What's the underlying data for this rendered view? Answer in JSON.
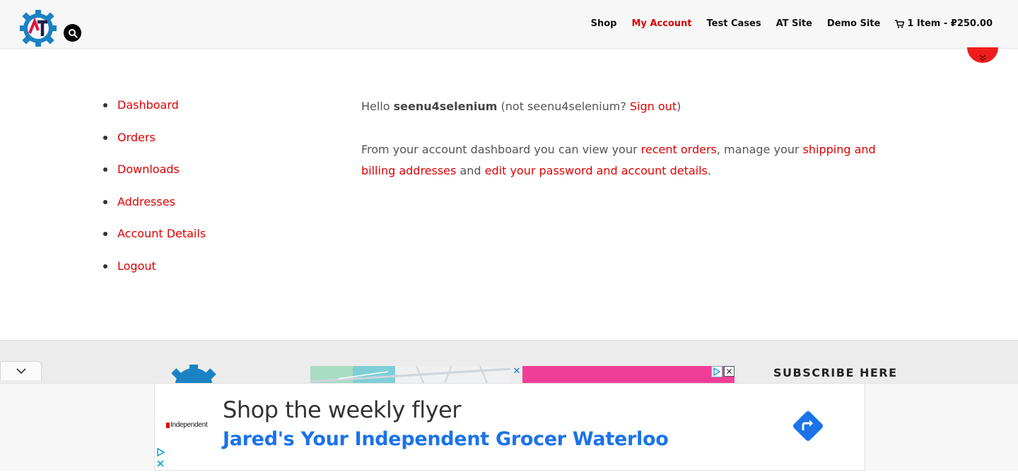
{
  "header": {
    "logo_alt": "AT",
    "nav": [
      {
        "label": "Shop",
        "active": false
      },
      {
        "label": "My Account",
        "active": true
      },
      {
        "label": "Test Cases",
        "active": false
      },
      {
        "label": "AT Site",
        "active": false
      },
      {
        "label": "Demo Site",
        "active": false
      }
    ],
    "cart_label": "1 Item - ₽250.00"
  },
  "account_nav": [
    {
      "label": "Dashboard"
    },
    {
      "label": "Orders"
    },
    {
      "label": "Downloads"
    },
    {
      "label": "Addresses"
    },
    {
      "label": "Account Details"
    },
    {
      "label": "Logout"
    }
  ],
  "dashboard": {
    "hello": "Hello ",
    "username": "seenu4selenium",
    "not_prefix": " (not seenu4selenium? ",
    "signout": "Sign out",
    "not_suffix": ")",
    "intro_1": "From your account dashboard you can view your ",
    "recent_orders": "recent orders",
    "intro_2": ", manage your ",
    "shipping_billing": "shipping and billing addresses",
    "intro_3": " and ",
    "edit_password": "edit your password and account details",
    "intro_4": "."
  },
  "footer": {
    "subscribe_title": "SUBSCRIBE HERE"
  },
  "ad": {
    "brand": "Independent",
    "headline": "Shop the weekly flyer",
    "subline": "Jared's Your Independent Grocer Waterloo"
  },
  "colors": {
    "accent": "#e00000",
    "ad_link": "#1a73e8",
    "ad_pink": "#ef3e97"
  }
}
